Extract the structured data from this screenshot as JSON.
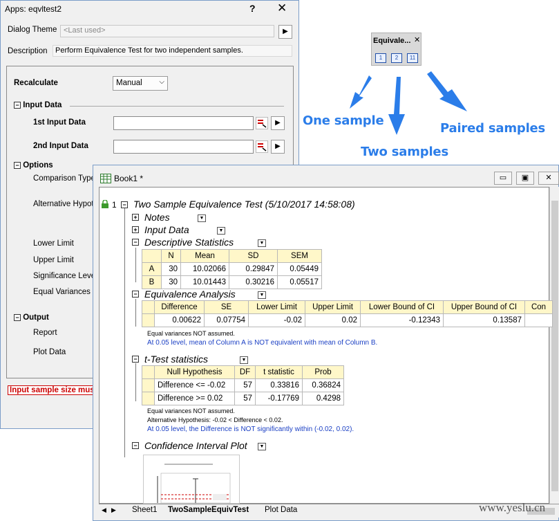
{
  "dialog": {
    "title": "Apps: eqvltest2",
    "help": "?",
    "close": "✕",
    "theme_label": "Dialog Theme",
    "theme_value": "<Last used>",
    "description_label": "Description",
    "description_value": "Perform Equivalence Test for two independent samples.",
    "recalculate_label": "Recalculate",
    "recalculate_value": "Manual",
    "input_data_section": "Input Data",
    "first_input_label": "1st Input Data",
    "second_input_label": "2nd Input Data",
    "options_section": "Options",
    "comparison_type_label": "Comparison Type",
    "alternative_label": "Alternative Hypoth",
    "lower_limit_label": "Lower Limit",
    "upper_limit_label": "Upper Limit",
    "significance_label": "Significance Level",
    "equal_variances_label": "Equal Variances",
    "output_section": "Output",
    "report_label": "Report",
    "plot_data_label": "Plot Data",
    "error_message": "Input sample size mus"
  },
  "mini_toolbar": {
    "title": "Equivale...",
    "close": "✕",
    "buttons": [
      "1",
      "2",
      "11"
    ]
  },
  "annotations": {
    "one": "One sample",
    "two": "Two samples",
    "paired": "Paired samples"
  },
  "workbook": {
    "title": "Book1 *",
    "row_number": "1",
    "report_title": "Two Sample Equivalence Test (5/10/2017 14:58:08)",
    "sections": {
      "notes": "Notes",
      "input_data": "Input Data",
      "descriptive": "Descriptive Statistics",
      "equivalence": "Equivalence Analysis",
      "ttest": "t-Test statistics",
      "ci_plot": "Confidence Interval Plot"
    },
    "descriptive_table": {
      "headers": [
        "N",
        "Mean",
        "SD",
        "SEM"
      ],
      "rows": [
        {
          "label": "A",
          "cells": [
            "30",
            "10.02066",
            "0.29847",
            "0.05449"
          ]
        },
        {
          "label": "B",
          "cells": [
            "30",
            "10.01443",
            "0.30216",
            "0.05517"
          ]
        }
      ]
    },
    "equivalence_table": {
      "headers": [
        "Difference",
        "SE",
        "Lower Limit",
        "Upper Limit",
        "Lower Bound of CI",
        "Upper Bound of CI",
        "Con"
      ],
      "row": [
        "0.00622",
        "0.07754",
        "-0.02",
        "0.02",
        "-0.12343",
        "0.13587",
        ""
      ]
    },
    "equivalence_note": "Equal variances NOT assumed.",
    "equivalence_conclusion": "At 0.05 level, mean of Column A is NOT equivalent with mean of Column B.",
    "ttest_table": {
      "headers": [
        "Null Hypothesis",
        "DF",
        "t statistic",
        "Prob"
      ],
      "rows": [
        [
          "Difference <= -0.02",
          "57",
          "0.33816",
          "0.36824"
        ],
        [
          "Difference >= 0.02",
          "57",
          "-0.17769",
          "0.4298"
        ]
      ]
    },
    "ttest_note1": "Equal variances NOT assumed.",
    "ttest_note2": "Alternative Hypothesis: -0.02 < Difference < 0.02.",
    "ttest_conclusion": "At 0.05 level, the Difference is NOT significantly within (-0.02, 0.02).",
    "tabs": [
      "Sheet1",
      "TwoSampleEquivTest",
      "Plot Data"
    ]
  },
  "watermark": "www.yeslu.cn",
  "colors": {
    "annotation_blue": "#2b7de9",
    "header_yellow": "#fff7c9",
    "conclusion_blue": "#1a3fc4",
    "error_red": "#cc0000"
  }
}
